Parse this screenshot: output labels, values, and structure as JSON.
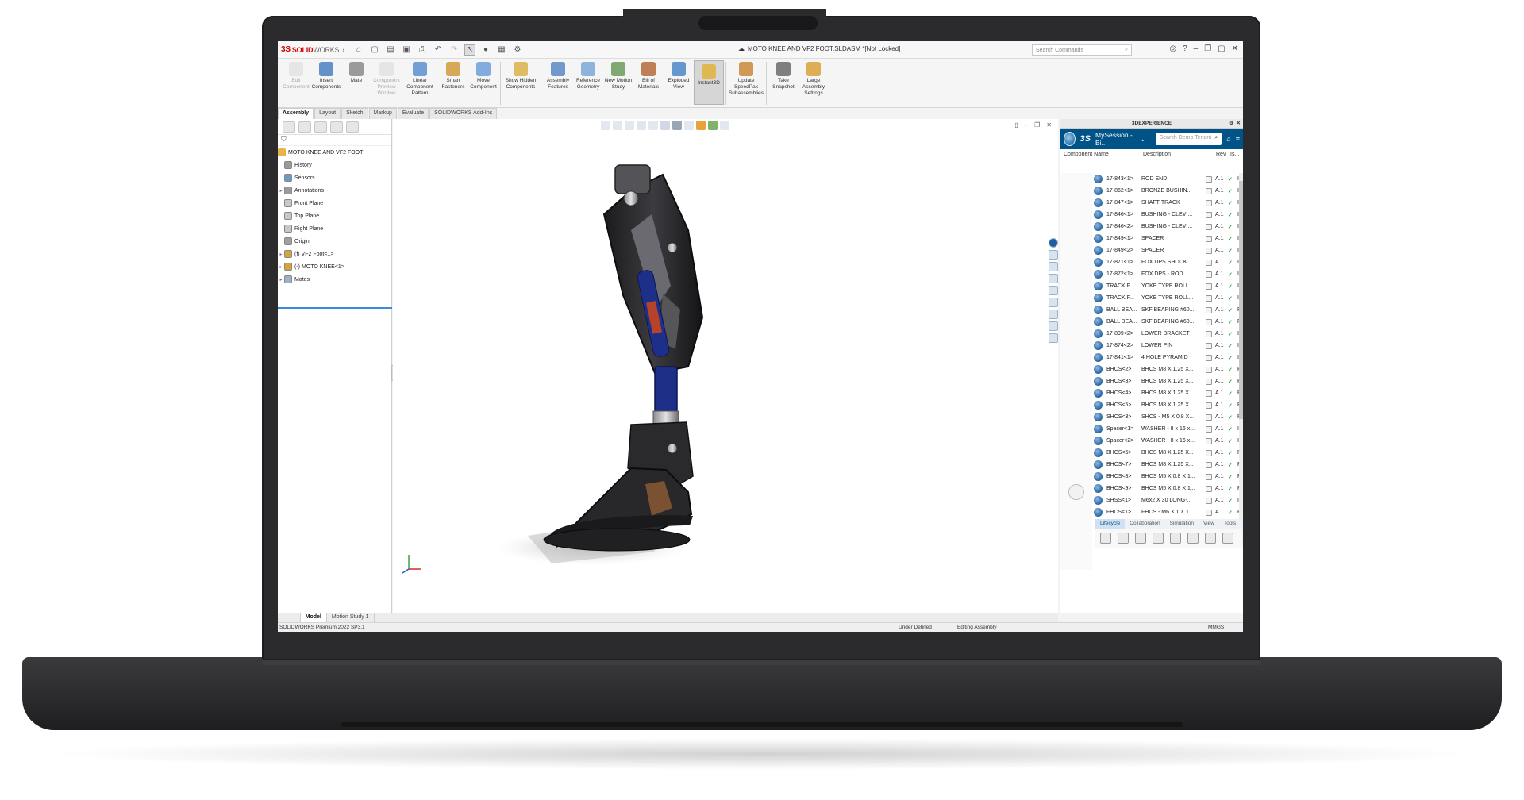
{
  "app": {
    "brand_ds": "3S",
    "brand_solid": "SOLID",
    "brand_works": "WORKS",
    "document_title": "MOTO KNEE AND VF2 FOOT.SLDASM *[Not Locked]",
    "search_placeholder": "Search Commands"
  },
  "command_manager": {
    "items": [
      {
        "label": "Edit Component",
        "disabled": true
      },
      {
        "label": "Insert Components",
        "disabled": false
      },
      {
        "label": "Mate",
        "disabled": false
      },
      {
        "label": "Component Preview Window",
        "disabled": true
      },
      {
        "label": "Linear Component Pattern",
        "disabled": false
      },
      {
        "label": "Smart Fasteners",
        "disabled": false
      },
      {
        "label": "Move Component",
        "disabled": false
      },
      {
        "label": "Show Hidden Components",
        "disabled": false
      },
      {
        "label": "Assembly Features",
        "disabled": false
      },
      {
        "label": "Reference Geometry",
        "disabled": false
      },
      {
        "label": "New Motion Study",
        "disabled": false
      },
      {
        "label": "Bill of Materials",
        "disabled": false
      },
      {
        "label": "Exploded View",
        "disabled": false
      },
      {
        "label": "Instant3D",
        "disabled": false
      },
      {
        "label": "Update SpeedPak Subassemblies",
        "disabled": false
      },
      {
        "label": "Take Snapshot",
        "disabled": false
      },
      {
        "label": "Large Assembly Settings",
        "disabled": false
      }
    ],
    "tabs": [
      "Assembly",
      "Layout",
      "Sketch",
      "Markup",
      "Evaluate",
      "SOLIDWORKS Add-Ins"
    ],
    "active_tab": "Assembly"
  },
  "feature_tree": {
    "root": "MOTO KNEE AND VF2 FOOT",
    "items": [
      {
        "label": "History",
        "expandable": false
      },
      {
        "label": "Sensors",
        "expandable": false
      },
      {
        "label": "Annotations",
        "expandable": true
      },
      {
        "label": "Front Plane",
        "expandable": false
      },
      {
        "label": "Top Plane",
        "expandable": false
      },
      {
        "label": "Right Plane",
        "expandable": false
      },
      {
        "label": "Origin",
        "expandable": false
      },
      {
        "label": "(f) VF2 Foot<1>",
        "expandable": true
      },
      {
        "label": "(-) MOTO KNEE<1>",
        "expandable": true
      },
      {
        "label": "Mates",
        "expandable": true
      }
    ]
  },
  "xp_panel": {
    "title": "3DEXPERIENCE",
    "session": "MySession - Bi...",
    "search_placeholder": "Search Demo Tenant",
    "columns": [
      "Component Name",
      "Description",
      "Rev",
      "Is...",
      "Maturity State"
    ],
    "rows": [
      {
        "name": "17-843<1>",
        "desc": "ROD END",
        "rev": "A.1",
        "state": "In Work"
      },
      {
        "name": "17-862<1>",
        "desc": "BRONZE BUSHIN...",
        "rev": "A.1",
        "state": "In Work"
      },
      {
        "name": "17-847<1>",
        "desc": "SHAFT-TRACK",
        "rev": "A.1",
        "state": "In Work"
      },
      {
        "name": "17-846<1>",
        "desc": "BUSHING - CLEVI...",
        "rev": "A.1",
        "state": "In Work"
      },
      {
        "name": "17-846<2>",
        "desc": "BUSHING - CLEVI...",
        "rev": "A.1",
        "state": "In Work"
      },
      {
        "name": "17-849<1>",
        "desc": "SPACER",
        "rev": "A.1",
        "state": "In Work"
      },
      {
        "name": "17-849<2>",
        "desc": "SPACER",
        "rev": "A.1",
        "state": "In Work"
      },
      {
        "name": "17-871<1>",
        "desc": "FOX DPS SHOCK...",
        "rev": "A.1",
        "state": "In Work"
      },
      {
        "name": "17-872<1>",
        "desc": "FOX DPS - ROD",
        "rev": "A.1",
        "state": "In Work"
      },
      {
        "name": "TRACK F...",
        "desc": "YOKE TYPE ROLL...",
        "rev": "A.1",
        "state": "In Work"
      },
      {
        "name": "TRACK F...",
        "desc": "YOKE TYPE ROLL...",
        "rev": "A.1",
        "state": "In Work"
      },
      {
        "name": "BALL BEA...",
        "desc": "SKF BEARING #60...",
        "rev": "A.1",
        "state": "Released"
      },
      {
        "name": "BALL BEA...",
        "desc": "SKF BEARING #60...",
        "rev": "A.1",
        "state": "Released"
      },
      {
        "name": "17-899<2>",
        "desc": "LOWER BRACKET",
        "rev": "A.1",
        "state": "In Work"
      },
      {
        "name": "17-874<2>",
        "desc": "LOWER PIN",
        "rev": "A.1",
        "state": "In Work"
      },
      {
        "name": "17-841<1>",
        "desc": "4 HOLE PYRAMID",
        "rev": "A.1",
        "state": "In Work"
      },
      {
        "name": "BHCS<2>",
        "desc": "BHCS M8 X 1.25 X...",
        "rev": "A.1",
        "state": "Released"
      },
      {
        "name": "BHCS<3>",
        "desc": "BHCS M8 X 1.25 X...",
        "rev": "A.1",
        "state": "Released"
      },
      {
        "name": "BHCS<4>",
        "desc": "BHCS M8 X 1.25 X...",
        "rev": "A.1",
        "state": "Released"
      },
      {
        "name": "BHCS<5>",
        "desc": "BHCS M8 X 1.25 X...",
        "rev": "A.1",
        "state": "Released"
      },
      {
        "name": "SHCS<3>",
        "desc": "SHCS - M5 X 0.8 X...",
        "rev": "A.1",
        "state": "Released"
      },
      {
        "name": "Spacer<1>",
        "desc": "WASHER - 8 x 16 x...",
        "rev": "A.1",
        "state": "In Work"
      },
      {
        "name": "Spacer<2>",
        "desc": "WASHER - 8 x 16 x...",
        "rev": "A.1",
        "state": "In Work"
      },
      {
        "name": "BHCS<6>",
        "desc": "BHCS M8 X 1.25 X...",
        "rev": "A.1",
        "state": "Released"
      },
      {
        "name": "BHCS<7>",
        "desc": "BHCS M8 X 1.25 X...",
        "rev": "A.1",
        "state": "Released"
      },
      {
        "name": "BHCS<8>",
        "desc": "BHCS M5 X 0.8 X 1...",
        "rev": "A.1",
        "state": "Released"
      },
      {
        "name": "BHCS<9>",
        "desc": "BHCS M5 X 0.8 X 1...",
        "rev": "A.1",
        "state": "Released"
      },
      {
        "name": "SHSS<1>",
        "desc": "M6x2 X 30 LONG-...",
        "rev": "A.1",
        "state": "In Work"
      },
      {
        "name": "FHCS<1>",
        "desc": "FHCS - M6 X 1 X 1...",
        "rev": "A.1",
        "state": "Released"
      },
      {
        "name": "FHCS<2>",
        "desc": "FHCS - M6 X 1 X 1...",
        "rev": "A.1",
        "state": "Released"
      }
    ],
    "bottom_tabs": [
      "Lifecycle",
      "Collaboration",
      "Simulation",
      "View",
      "Tools"
    ],
    "active_bottom_tab": "Lifecycle"
  },
  "bottom_tabs": [
    "Model",
    "Motion Study 1"
  ],
  "active_bottom_tab": "Model",
  "status": {
    "product": "SOLIDWORKS Premium 2022 SP3.1",
    "definition": "Under Defined",
    "mode": "Editing Assembly",
    "units": "MMGS"
  },
  "colors": {
    "xp_header_blue": "#005386",
    "released_check": "#2ba34a",
    "solidworks_red": "#d40000"
  }
}
